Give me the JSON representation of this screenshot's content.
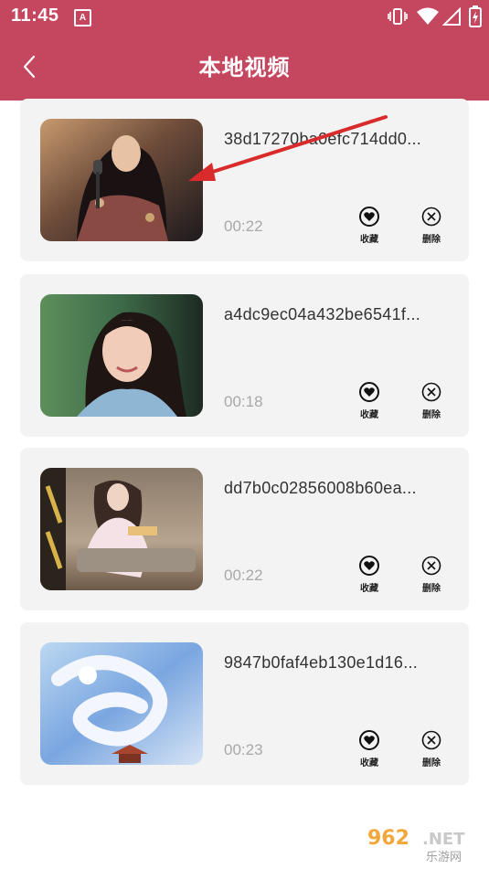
{
  "colors": {
    "brand": "#c5475f",
    "arrow": "#d92b2b"
  },
  "status_bar": {
    "time": "11:45",
    "notification_badge": "A",
    "icons": [
      "vibrate-icon",
      "wifi-icon",
      "signal-icon",
      "battery-icon"
    ]
  },
  "header": {
    "title": "本地视频",
    "back_icon": "chevron-left-icon"
  },
  "videos": [
    {
      "name": "38d17270ba0efc714dd0...",
      "duration": "00:22",
      "favorite_label": "收藏",
      "delete_label": "删除"
    },
    {
      "name": "a4dc9ec04a432be6541f...",
      "duration": "00:18",
      "favorite_label": "收藏",
      "delete_label": "删除"
    },
    {
      "name": "dd7b0c02856008b60ea...",
      "duration": "00:22",
      "favorite_label": "收藏",
      "delete_label": "删除"
    },
    {
      "name": "9847b0faf4eb130e1d16...",
      "duration": "00:23",
      "favorite_label": "收藏",
      "delete_label": "删除"
    }
  ],
  "watermark": {
    "brand": "962.NET",
    "subtitle": "乐游网"
  }
}
